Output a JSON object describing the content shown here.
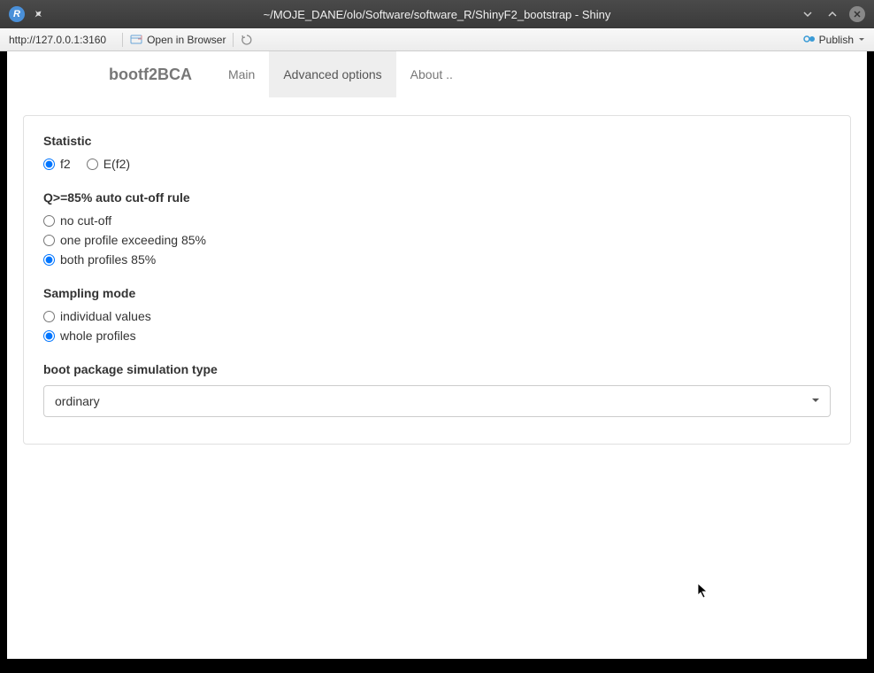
{
  "window": {
    "title": "~/MOJE_DANE/olo/Software/software_R/ShinyF2_bootstrap - Shiny",
    "app_icon_letter": "R"
  },
  "toolbar": {
    "url": "http://127.0.0.1:3160",
    "open_browser": "Open in Browser",
    "publish": "Publish"
  },
  "navbar": {
    "title": "bootf2BCA",
    "tabs": [
      {
        "label": "Main",
        "active": false
      },
      {
        "label": "Advanced options",
        "active": true
      },
      {
        "label": "About ..",
        "active": false
      }
    ]
  },
  "panel": {
    "statistic": {
      "label": "Statistic",
      "options": [
        {
          "label": "f2",
          "selected": true
        },
        {
          "label": "E(f2)",
          "selected": false
        }
      ]
    },
    "cutoff": {
      "label": "Q>=85% auto cut-off rule",
      "options": [
        {
          "label": "no cut-off",
          "selected": false
        },
        {
          "label": "one profile exceeding 85%",
          "selected": false
        },
        {
          "label": "both profiles 85%",
          "selected": true
        }
      ]
    },
    "sampling": {
      "label": "Sampling mode",
      "options": [
        {
          "label": "individual values",
          "selected": false
        },
        {
          "label": "whole profiles",
          "selected": true
        }
      ]
    },
    "simtype": {
      "label": "boot package simulation type",
      "value": "ordinary"
    }
  }
}
